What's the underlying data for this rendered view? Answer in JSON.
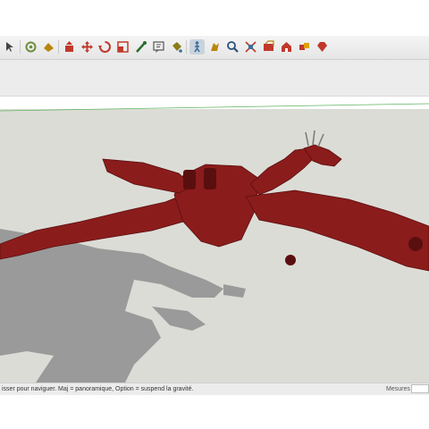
{
  "toolbar": {
    "tools": [
      {
        "icon": "select-arrow-icon",
        "color": "#444444",
        "active": false
      },
      {
        "icon": "orbit-icon",
        "color": "#6b8e3c",
        "active": false
      },
      {
        "icon": "look-around-icon",
        "color": "#b8860b",
        "active": false
      },
      {
        "icon": "push-pull-icon",
        "color": "#c0392b",
        "active": false
      },
      {
        "icon": "move-icon",
        "color": "#c0392b",
        "active": false
      },
      {
        "icon": "rotate-icon",
        "color": "#c0392b",
        "active": false
      },
      {
        "icon": "scale-icon",
        "color": "#c0392b",
        "active": false
      },
      {
        "icon": "tape-measure-icon",
        "color": "#2c6e2c",
        "active": false
      },
      {
        "icon": "text-label-icon",
        "color": "#555555",
        "active": false
      },
      {
        "icon": "paint-bucket-icon",
        "color": "#8a7a1a",
        "active": false
      },
      {
        "icon": "walk-icon",
        "color": "#3a6f9b",
        "active": true
      },
      {
        "icon": "position-camera-icon",
        "color": "#b8860b",
        "active": false
      },
      {
        "icon": "zoom-icon",
        "color": "#2a4f7a",
        "active": false
      },
      {
        "icon": "zoom-extents-icon",
        "color": "#c0392b",
        "active": false
      },
      {
        "icon": "section-plane-icon",
        "color": "#c0392b",
        "active": false
      },
      {
        "icon": "warehouse-icon",
        "color": "#c0392b",
        "active": false
      },
      {
        "icon": "components-icon",
        "color": "#c0392b",
        "active": false
      },
      {
        "icon": "extension-ruby-icon",
        "color": "#c0392b",
        "active": false
      }
    ]
  },
  "statusbar": {
    "hint": "isser pour naviguer. Maj = panoramique, Option =  suspend la gravité.",
    "measure_label": "Mesures",
    "measure_value": ""
  },
  "scene": {
    "ground_color": "#dcdcd6",
    "sky_color": "#ffffff",
    "shadow_color": "#9a9a9a",
    "model_color": "#8b1c1c",
    "model_dark": "#5a0f0f",
    "axis_green": "#5fb35f"
  }
}
